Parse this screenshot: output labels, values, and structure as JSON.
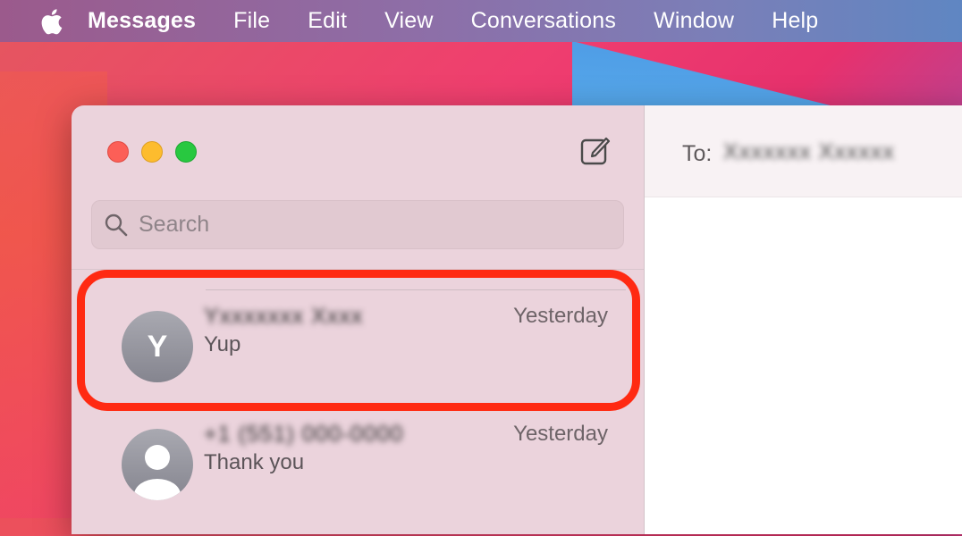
{
  "menubar": {
    "apple_icon": "apple-logo-icon",
    "app_name": "Messages",
    "items": [
      "File",
      "Edit",
      "View",
      "Conversations",
      "Window",
      "Help"
    ]
  },
  "window": {
    "compose_icon": "compose-icon",
    "search": {
      "placeholder": "Search",
      "value": ""
    },
    "conversations": [
      {
        "name": "Yxxxxxxx Xxxx",
        "time": "Yesterday",
        "preview": "Yup",
        "avatar_initial": "Y"
      },
      {
        "name": "+1 (551) 000-0000",
        "time": "Yesterday",
        "preview": "Thank you",
        "avatar_initial": ""
      }
    ],
    "main": {
      "to_label": "To:",
      "to_value": "Xxxxxxx Xxxxxx"
    }
  },
  "colors": {
    "highlight": "#ff2a12",
    "sidebar": "#ebd3dc"
  }
}
